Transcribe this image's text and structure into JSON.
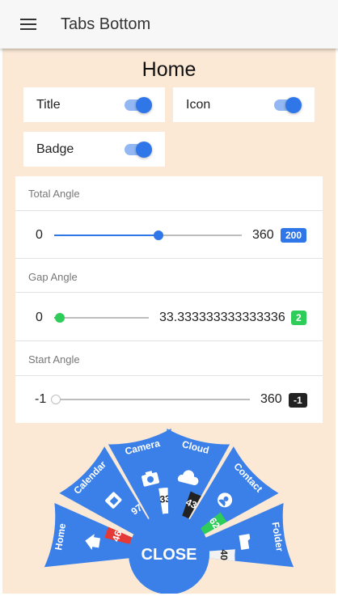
{
  "appbar": {
    "title": "Tabs Bottom",
    "menu_icon": "hamburger-menu-icon"
  },
  "page": {
    "title": "Home"
  },
  "toggles": {
    "title": {
      "label": "Title",
      "checked": true
    },
    "icon": {
      "label": "Icon",
      "checked": true
    },
    "badge": {
      "label": "Badge",
      "checked": true
    }
  },
  "sliders": {
    "total_angle": {
      "label": "Total Angle",
      "min": "0",
      "max": "360",
      "value": 200,
      "value_label": "200",
      "color": "#2f76e8"
    },
    "gap_angle": {
      "label": "Gap Angle",
      "min": "0",
      "max": "33.333333333333336",
      "value": 2,
      "value_label": "2",
      "color": "#2ecc58"
    },
    "start_angle": {
      "label": "Start Angle",
      "min": "-1",
      "max": "360",
      "value": -1,
      "value_label": "-1",
      "color": "#222222"
    }
  },
  "menu": {
    "close_label": "CLOSE",
    "accent": "#3b80e8",
    "tabs": [
      {
        "label": "Home",
        "icon": "home-icon",
        "badge": "46",
        "badge_color": "#e53935"
      },
      {
        "label": "Calendar",
        "icon": "calendar-icon",
        "badge": "97",
        "badge_color": "#3b80e8"
      },
      {
        "label": "Camera",
        "icon": "camera-icon",
        "badge": "33",
        "badge_color": "#ffffff"
      },
      {
        "label": "Cloud",
        "icon": "cloud-icon",
        "badge": "43",
        "badge_color": "#222222"
      },
      {
        "label": "Contact",
        "icon": "contact-icon",
        "badge": "62",
        "badge_color": "#2ecc58"
      },
      {
        "label": "Folder",
        "icon": "folder-icon",
        "badge": "40",
        "badge_color": "#f2f2f2"
      }
    ]
  }
}
